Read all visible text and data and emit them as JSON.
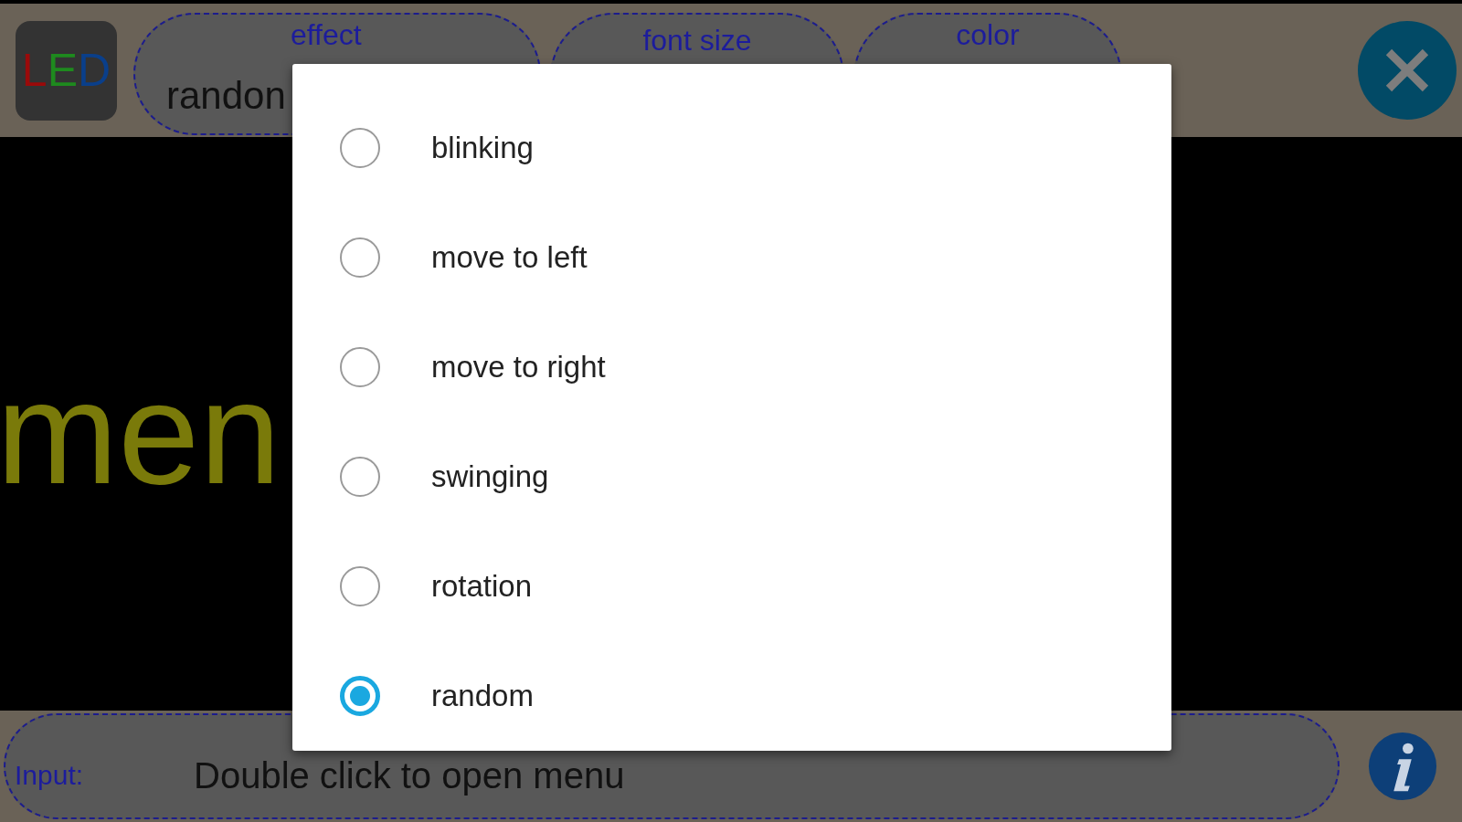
{
  "logo": {
    "letters": [
      {
        "text": "L",
        "color": "#9a0a0a"
      },
      {
        "text": "E",
        "color": "#1e8a1e"
      },
      {
        "text": "D",
        "color": "#0a3f8a"
      }
    ]
  },
  "top_tabs": [
    {
      "label": "effect",
      "value": "randon"
    },
    {
      "label": "font size"
    },
    {
      "label": "color"
    }
  ],
  "display_text": "men",
  "input": {
    "label": "Input:",
    "value": "Double click to open menu"
  },
  "dialog": {
    "options": [
      {
        "label": "blinking",
        "selected": false
      },
      {
        "label": "move to left",
        "selected": false
      },
      {
        "label": "move to right",
        "selected": false
      },
      {
        "label": "swinging",
        "selected": false
      },
      {
        "label": "rotation",
        "selected": false
      },
      {
        "label": "random",
        "selected": true
      }
    ]
  }
}
